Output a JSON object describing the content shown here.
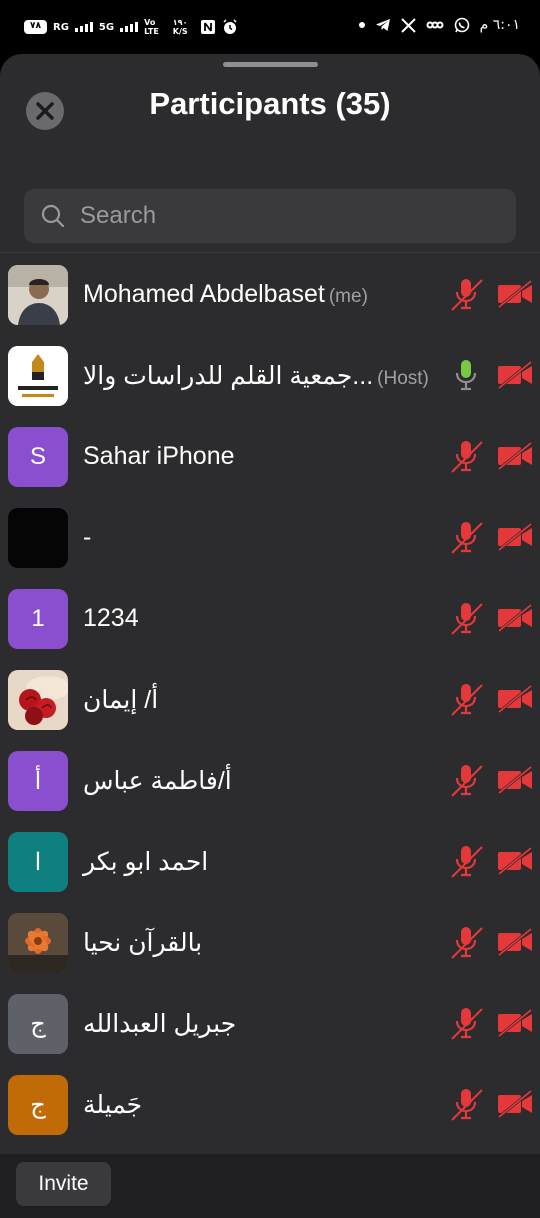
{
  "status_bar": {
    "battery": "٧٨",
    "net1": "RG",
    "net2": "5G",
    "volte_top": "Vo",
    "volte_bottom": "LTE",
    "speed_top": "١٩٠",
    "speed_bottom": "K/S",
    "time": "٦:٠١ م",
    "icons_left": [
      "nfc-icon",
      "alarm-icon"
    ],
    "icons_right": [
      "dot",
      "telegram-icon",
      "x-icon",
      "link-icon",
      "whatsapp-icon"
    ]
  },
  "header": {
    "title": "Participants (35)",
    "close_icon": "close-icon"
  },
  "search": {
    "placeholder": "Search",
    "value": ""
  },
  "participants": [
    {
      "name": "Mohamed Abdelbaset",
      "tag": "(me)",
      "avatar_letter": "",
      "avatar_type": "photo-man",
      "avatar_color": "#c9c2b8",
      "mic": "muted",
      "video": "off"
    },
    {
      "name": "جمعية القلم للدراسات والا...",
      "tag": "(Host)",
      "avatar_letter": "",
      "avatar_type": "logo",
      "avatar_color": "#ffffff",
      "mic": "active",
      "video": "off"
    },
    {
      "name": " Sahar iPhone",
      "tag": "",
      "avatar_letter": "S",
      "avatar_type": "letter",
      "avatar_color": "#8a4fcf",
      "mic": "muted",
      "video": "off"
    },
    {
      "name": "-",
      "tag": "",
      "avatar_letter": "",
      "avatar_type": "black",
      "avatar_color": "#050505",
      "mic": "muted",
      "video": "off"
    },
    {
      "name": "1234",
      "tag": "",
      "avatar_letter": "1",
      "avatar_type": "letter",
      "avatar_color": "#8a4fcf",
      "mic": "muted",
      "video": "off"
    },
    {
      "name": "أ/ إيمان",
      "tag": "",
      "avatar_letter": "",
      "avatar_type": "photo-roses",
      "avatar_color": "#a82a2a",
      "mic": "muted",
      "video": "off"
    },
    {
      "name": "أ/فاطمة عباس",
      "tag": "",
      "avatar_letter": "أ",
      "avatar_type": "letter",
      "avatar_color": "#8a4fcf",
      "mic": "muted",
      "video": "off"
    },
    {
      "name": "احمد ابو بكر",
      "tag": "",
      "avatar_letter": "ا",
      "avatar_type": "letter",
      "avatar_color": "#0e8080",
      "mic": "muted",
      "video": "off"
    },
    {
      "name": "بالقرآن نحيا",
      "tag": "",
      "avatar_letter": "",
      "avatar_type": "photo-flower",
      "avatar_color": "#6e5a48",
      "mic": "muted",
      "video": "off"
    },
    {
      "name": "جبريل  العبدالله",
      "tag": "",
      "avatar_letter": "ج",
      "avatar_type": "letter",
      "avatar_color": "#5e6168",
      "mic": "muted",
      "video": "off"
    },
    {
      "name": "جَميلة",
      "tag": "",
      "avatar_letter": "ج",
      "avatar_type": "letter",
      "avatar_color": "#c06a08",
      "mic": "muted",
      "video": "off"
    }
  ],
  "colors": {
    "muted_red": "#e5383b",
    "mic_active_green": "#7ac943",
    "sheet_bg": "#2c2c2e"
  },
  "footer": {
    "invite_label": "Invite"
  }
}
